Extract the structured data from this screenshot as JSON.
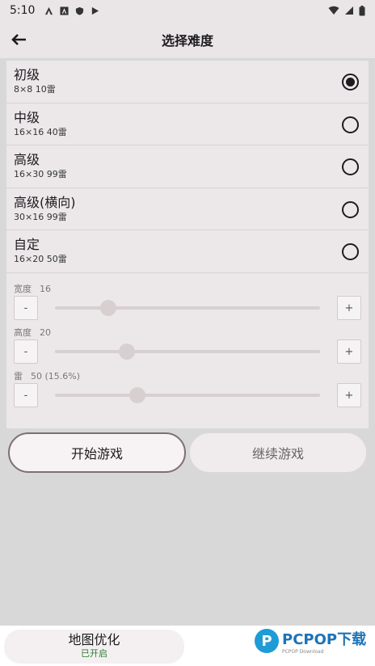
{
  "status": {
    "time": "5:10"
  },
  "header": {
    "title": "选择难度"
  },
  "difficulties": [
    {
      "name": "初级",
      "desc": "8×8  10雷",
      "selected": true
    },
    {
      "name": "中级",
      "desc": "16×16  40雷",
      "selected": false
    },
    {
      "name": "高级",
      "desc": "16×30  99雷",
      "selected": false
    },
    {
      "name": "高级(横向)",
      "desc": "30×16  99雷",
      "selected": false
    },
    {
      "name": "自定",
      "desc": "16×20  50雷",
      "selected": false
    }
  ],
  "custom": {
    "width": {
      "label": "宽度",
      "value": "16",
      "fraction": 0.2
    },
    "height": {
      "label": "高度",
      "value": "20",
      "fraction": 0.27
    },
    "mines": {
      "label": "雷",
      "value": "50 (15.6%)",
      "fraction": 0.31
    },
    "minus": "-",
    "plus": "+"
  },
  "actions": {
    "start": "开始游戏",
    "continue": "继续游戏"
  },
  "bottom": {
    "map_title": "地图优化",
    "map_status": "已开启"
  },
  "watermark": {
    "brand": "PCPOP下载",
    "sub": "PCPOP Download"
  },
  "colors": {
    "accent": "#1c1b1f",
    "background": "#d8d8d8",
    "panel": "#ece8ea",
    "status_green": "#2e7d32",
    "brand_blue": "#1f9bd6"
  }
}
